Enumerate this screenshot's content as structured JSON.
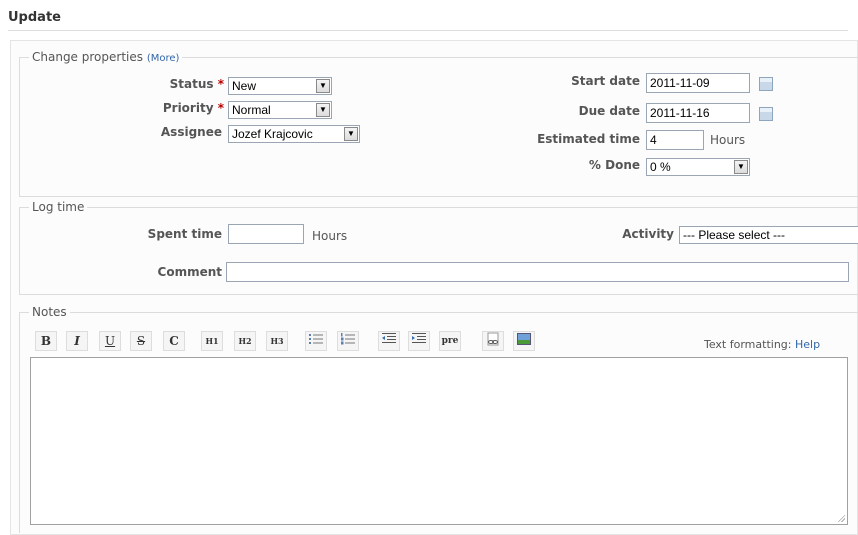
{
  "header": {
    "title": "Update"
  },
  "properties": {
    "legend": "Change properties",
    "more_link": "(More)",
    "status": {
      "label": "Status",
      "required": "*",
      "value": "New"
    },
    "priority": {
      "label": "Priority",
      "required": "*",
      "value": "Normal"
    },
    "assignee": {
      "label": "Assignee",
      "value": "Jozef Krajcovic"
    },
    "start_date": {
      "label": "Start date",
      "value": "2011-11-09"
    },
    "due_date": {
      "label": "Due date",
      "value": "2011-11-16"
    },
    "estimated_time": {
      "label": "Estimated time",
      "value": "4",
      "unit": "Hours"
    },
    "done": {
      "label": "% Done",
      "value": "0 %"
    }
  },
  "log_time": {
    "legend": "Log time",
    "spent_time": {
      "label": "Spent time",
      "value": "",
      "unit": "Hours"
    },
    "activity": {
      "label": "Activity",
      "value": "--- Please select ---"
    },
    "comment": {
      "label": "Comment",
      "value": ""
    }
  },
  "notes": {
    "legend": "Notes",
    "toolbar": [
      "B",
      "I",
      "U",
      "S",
      "C",
      "H1",
      "H2",
      "H3",
      "ul",
      "ol",
      "indent-left",
      "indent-right",
      "pre",
      "link",
      "image"
    ],
    "toolbar_labels": {
      "bold": "B",
      "italic": "I",
      "underline": "U",
      "strike": "S",
      "code": "C",
      "h1": "H1",
      "h2": "H2",
      "h3": "H3",
      "pre": "pre"
    },
    "text_formatting_label": "Text formatting:",
    "help_link": "Help",
    "value": ""
  }
}
